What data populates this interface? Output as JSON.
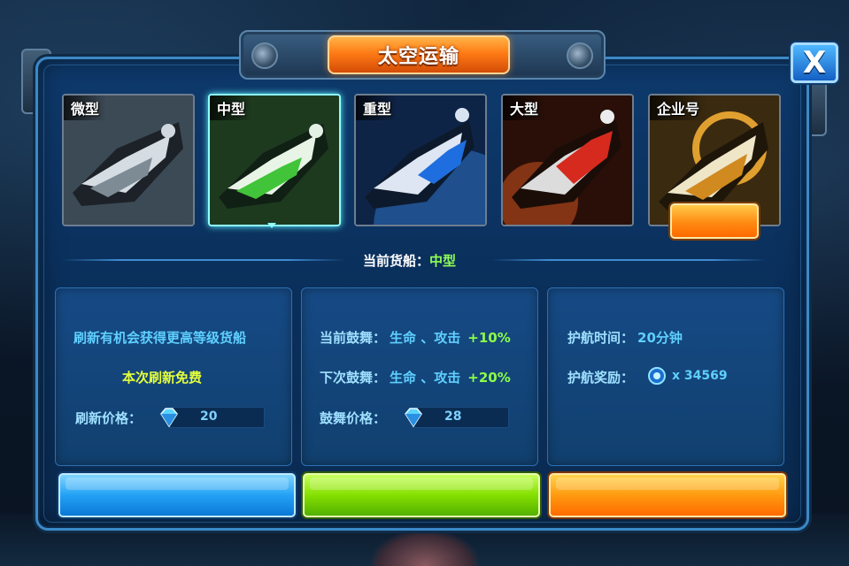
{
  "dialog": {
    "title": "太空运输",
    "close_label": "X"
  },
  "ships": [
    {
      "label": "微型",
      "color": "#e8f0f0"
    },
    {
      "label": "中型",
      "color": "#6adf4a"
    },
    {
      "label": "重型",
      "color": "#3d8ee8"
    },
    {
      "label": "大型",
      "color": "#e23a2a"
    },
    {
      "label": "企业号",
      "color": "#e8a52a"
    }
  ],
  "selected_ship_index": 1,
  "current_cargo": {
    "label": "当前货船：",
    "value": "中型"
  },
  "refresh_box": {
    "hint": "刷新有机会获得更高等级货船",
    "free_text": "本次刷新免费",
    "price_label": "刷新价格：",
    "price_value": "20",
    "currency_icon": "diamond-icon"
  },
  "inspire_box": {
    "current_label": "当前鼓舞：",
    "current_attr": "生命 、攻击",
    "current_bonus": "+10%",
    "next_label": "下次鼓舞：",
    "next_attr": "生命 、攻击",
    "next_bonus": "+20%",
    "price_label": "鼓舞价格：",
    "price_value": "28",
    "currency_icon": "diamond-icon"
  },
  "escort_box": {
    "time_label": "护航时间：",
    "time_value": "20分钟",
    "reward_label": "护航奖励：",
    "reward_value": "x 34569",
    "reward_icon": "energy-orb-icon"
  },
  "buttons": {
    "refresh_color": "#23a1f5",
    "inspire_color": "#84e000",
    "escort_color": "#ff9a10"
  }
}
